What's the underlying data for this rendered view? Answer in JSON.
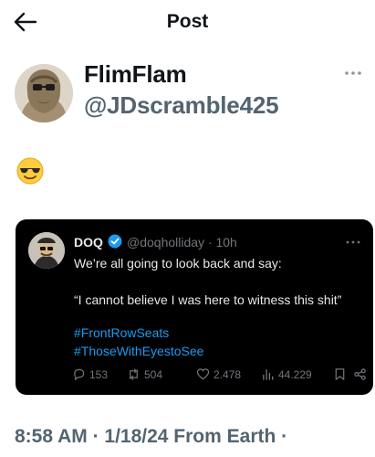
{
  "header": {
    "title": "Post"
  },
  "author": {
    "display_name": "FlimFlam",
    "handle": "@JDscramble425"
  },
  "tweet": {
    "text": "😎"
  },
  "quote": {
    "name": "DOQ",
    "handle_time": "@doqholliday · 10h",
    "line1": "We’re all going to look back and say:",
    "line2": "“I cannot believe I was here to witness this shit”",
    "hashtag1": "#FrontRowSeats",
    "hashtag2": "#ThoseWithEyestoSee",
    "stats": {
      "replies": "153",
      "reposts": "504",
      "likes": "2.478",
      "views": "44.229"
    }
  },
  "footer": {
    "timestamp": "8:58 AM · 1/18/24 From Earth ·"
  },
  "icons": {
    "back": "arrow-left-icon",
    "more": "more-horizontal-icon",
    "verified": "verified-badge-icon",
    "reply": "reply-icon",
    "repost": "repost-icon",
    "like": "heart-icon",
    "views": "views-icon",
    "bookmark": "bookmark-icon",
    "share": "share-icon"
  },
  "colors": {
    "link": "#1d9bf0",
    "muted": "#536471",
    "card_bg": "#000000"
  }
}
